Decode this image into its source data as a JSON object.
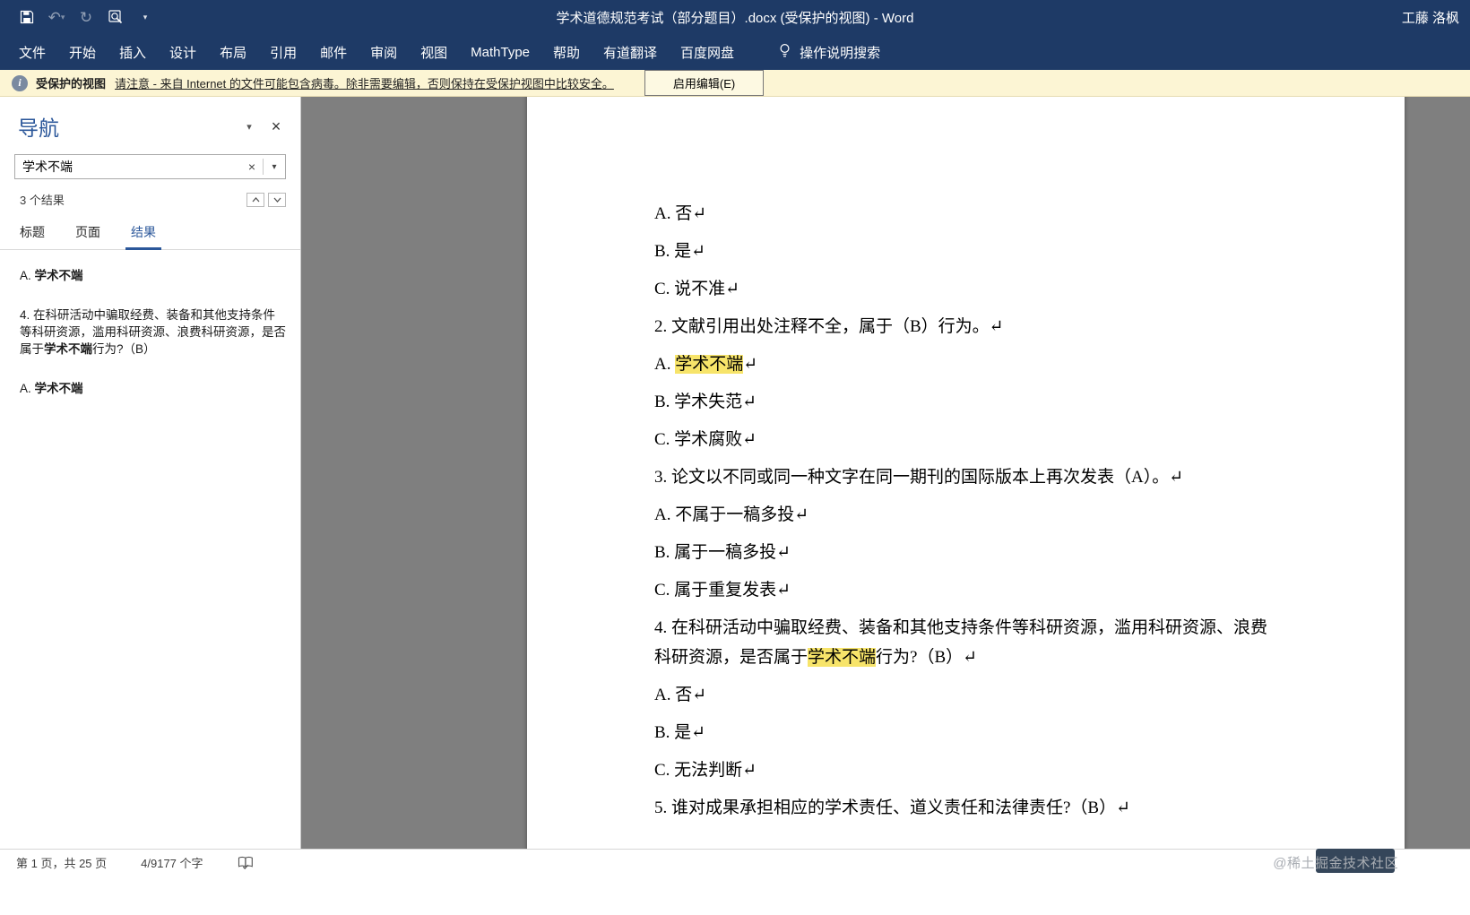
{
  "titlebar": {
    "title": "学术道德规范考试（部分题目）.docx (受保护的视图) - Word",
    "user": "工藤 洛枫"
  },
  "icons": {
    "save": "floppy-disk",
    "undo": "undo-arrow",
    "redo": "redo-arrow",
    "print_preview": "magnifier",
    "qat_customize": "chevron-down",
    "tell_me": "lightbulb",
    "protected_view": "info-circle",
    "nav_dropdown": "chevron-down",
    "nav_close": "x",
    "search_clear": "x",
    "search_dropdown": "chevron-down",
    "prev_result": "chevron-up",
    "next_result": "chevron-down",
    "proofing": "book-check"
  },
  "ribbon": {
    "tabs": [
      {
        "key": "file",
        "label": "文件"
      },
      {
        "key": "home",
        "label": "开始"
      },
      {
        "key": "insert",
        "label": "插入"
      },
      {
        "key": "design",
        "label": "设计"
      },
      {
        "key": "layout",
        "label": "布局"
      },
      {
        "key": "references",
        "label": "引用"
      },
      {
        "key": "mailings",
        "label": "邮件"
      },
      {
        "key": "review",
        "label": "审阅"
      },
      {
        "key": "view",
        "label": "视图"
      },
      {
        "key": "mathtype",
        "label": "MathType"
      },
      {
        "key": "help",
        "label": "帮助"
      },
      {
        "key": "youdao-translate",
        "label": "有道翻译"
      },
      {
        "key": "baidu-netdisk",
        "label": "百度网盘"
      }
    ],
    "tell_me": "操作说明搜索"
  },
  "protected_view": {
    "label": "受保护的视图",
    "message": "请注意 - 来自 Internet 的文件可能包含病毒。除非需要编辑，否则保持在受保护视图中比较安全。",
    "enable_button": "启用编辑(E)"
  },
  "navigation": {
    "title": "导航",
    "search": {
      "value": "学术不端"
    },
    "result_count": "3 个结果",
    "tabs": [
      {
        "key": "headings",
        "label": "标题",
        "active": false
      },
      {
        "key": "pages",
        "label": "页面",
        "active": false
      },
      {
        "key": "results",
        "label": "结果",
        "active": true
      }
    ],
    "results": [
      {
        "parts": [
          {
            "t": "A. "
          },
          {
            "t": "学术不端",
            "b": true
          }
        ]
      },
      {
        "parts": [
          {
            "t": "4. 在科研活动中骗取经费、装备和其他支持条件等科研资源，滥用科研资源、浪费科研资源，是否属于"
          },
          {
            "t": "学术不端",
            "b": true
          },
          {
            "t": "行为?（B）"
          }
        ]
      },
      {
        "parts": [
          {
            "t": "A. "
          },
          {
            "t": "学术不端",
            "b": true
          }
        ]
      }
    ]
  },
  "document": {
    "lines": [
      {
        "parts": [
          {
            "t": "A. 否↵"
          }
        ]
      },
      {
        "parts": [
          {
            "t": "B. 是↵"
          }
        ]
      },
      {
        "parts": [
          {
            "t": "C. 说不准↵"
          }
        ]
      },
      {
        "parts": [
          {
            "t": "2. 文献引用出处注释不全，属于（B）行为。↵"
          }
        ]
      },
      {
        "parts": [
          {
            "t": "A. "
          },
          {
            "t": "学术不端",
            "hl": true
          },
          {
            "t": "↵"
          }
        ]
      },
      {
        "parts": [
          {
            "t": "B. 学术失范↵"
          }
        ]
      },
      {
        "parts": [
          {
            "t": "C. 学术腐败↵"
          }
        ]
      },
      {
        "parts": [
          {
            "t": "3. 论文以不同或同一种文字在同一期刊的国际版本上再次发表（A）。↵"
          }
        ]
      },
      {
        "parts": [
          {
            "t": "A. 不属于一稿多投↵"
          }
        ]
      },
      {
        "parts": [
          {
            "t": "B. 属于一稿多投↵"
          }
        ]
      },
      {
        "parts": [
          {
            "t": "C. 属于重复发表↵"
          }
        ]
      },
      {
        "parts": [
          {
            "t": "4. 在科研活动中骗取经费、装备和其他支持条件等科研资源，滥用科研资源、浪费科研资源，是否属于"
          },
          {
            "t": "学术不端",
            "hl": true
          },
          {
            "t": "行为?（B）↵"
          }
        ]
      },
      {
        "parts": [
          {
            "t": "A. 否↵"
          }
        ]
      },
      {
        "parts": [
          {
            "t": "B. 是↵"
          }
        ]
      },
      {
        "parts": [
          {
            "t": "C. 无法判断↵"
          }
        ]
      },
      {
        "parts": [
          {
            "t": "5. 谁对成果承担相应的学术责任、道义责任和法律责任?（B）↵"
          }
        ]
      }
    ]
  },
  "statusbar": {
    "page_info": "第 1 页，共 25 页",
    "word_count": "4/9177 个字"
  },
  "watermark": {
    "text": "@稀土掘金技术社区"
  },
  "colors": {
    "titlebar": "#1e3a66",
    "accent": "#2b579a",
    "highlight": "#f7e46a",
    "warning_bg": "#fcf5d4",
    "canvas": "#7f7f7f"
  }
}
